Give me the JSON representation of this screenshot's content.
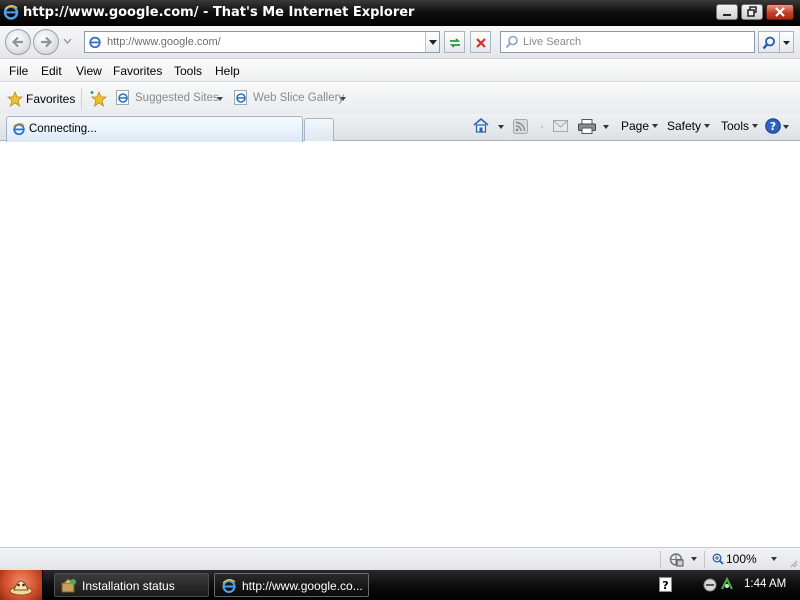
{
  "window": {
    "title": "http://www.google.com/ - That's Me Internet Explorer"
  },
  "address_bar": {
    "url": "http://www.google.com/"
  },
  "search": {
    "placeholder": "Live Search"
  },
  "menu": {
    "items": [
      "File",
      "Edit",
      "View",
      "Favorites",
      "Tools",
      "Help"
    ]
  },
  "favorites_bar": {
    "favorites_label": "Favorites",
    "links": [
      "Suggested Sites",
      "Web Slice Gallery"
    ]
  },
  "tabs": {
    "active_label": "Connecting..."
  },
  "command_bar": {
    "page": "Page",
    "safety": "Safety",
    "tools": "Tools"
  },
  "status_bar": {
    "zoom": "100%"
  },
  "taskbar": {
    "buttons": [
      "Installation status",
      "http://www.google.co..."
    ],
    "clock": "1:44 AM"
  },
  "colors": {
    "title_bar": "#000000",
    "accent_blue": "#1e5ab8",
    "start_button": "#d14f2a"
  },
  "icons": [
    "ie-logo-icon",
    "back-arrow-icon",
    "forward-arrow-icon",
    "refresh-icon",
    "stop-icon",
    "search-icon",
    "star-icon",
    "home-icon",
    "rss-feed-icon",
    "read-mail-icon",
    "print-icon",
    "help-icon",
    "protected-mode-icon",
    "zoom-icon",
    "mouse-cursor-icon"
  ]
}
